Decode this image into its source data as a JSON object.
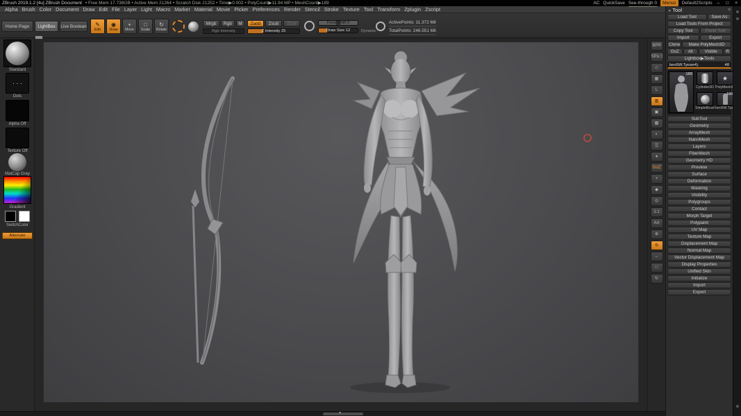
{
  "colors": {
    "accent_orange": "#c87616",
    "active_mode": "#e8962f",
    "cursor_ring": "#c44b3c"
  },
  "glyphs": {
    "pencil": "✎",
    "dot_brush": "◉",
    "move": "+",
    "scale": "□",
    "rotate": "↻",
    "chevron_down": "▾",
    "panel_collapse": "◂",
    "panel_menu": "≡",
    "star": "★",
    "dots_stroke": "· · ·"
  },
  "titlebar": {
    "app_title": "ZBrush 2019.1.2 [4u]  ZBrush Document",
    "stats": "•  Free Mem 17.738GB   •  Active Mem 21264   •  Scratch Disk 21252   •  Time▶0.002   •  PolyCount▶11.94 MP   •  MeshCount▶189",
    "ac": "AC",
    "quicksave": "QuickSave",
    "see_through": "See-through 0",
    "menus": "Menus",
    "scripts": "Default2Scripts",
    "window": {
      "minimize": "–",
      "maximize": "□",
      "close": "×"
    }
  },
  "menubar": {
    "items": [
      {
        "label": "Alpha",
        "name": "menu-alpha"
      },
      {
        "label": "Brush",
        "name": "menu-brush"
      },
      {
        "label": "Color",
        "name": "menu-color"
      },
      {
        "label": "Document",
        "name": "menu-document"
      },
      {
        "label": "Draw",
        "name": "menu-draw"
      },
      {
        "label": "Edit",
        "name": "menu-edit"
      },
      {
        "label": "File",
        "name": "menu-file"
      },
      {
        "label": "Layer",
        "name": "menu-layer"
      },
      {
        "label": "Light",
        "name": "menu-light"
      },
      {
        "label": "Macro",
        "name": "menu-macro"
      },
      {
        "label": "Marker",
        "name": "menu-marker"
      },
      {
        "label": "Material",
        "name": "menu-material"
      },
      {
        "label": "Movie",
        "name": "menu-movie"
      },
      {
        "label": "Picker",
        "name": "menu-picker"
      },
      {
        "label": "Preferences",
        "name": "menu-preferences"
      },
      {
        "label": "Render",
        "name": "menu-render"
      },
      {
        "label": "Stencil",
        "name": "menu-stencil"
      },
      {
        "label": "Stroke",
        "name": "menu-stroke"
      },
      {
        "label": "Texture",
        "name": "menu-texture"
      },
      {
        "label": "Tool",
        "name": "menu-tool"
      },
      {
        "label": "Transform",
        "name": "menu-transform"
      },
      {
        "label": "Zplugin",
        "name": "menu-zplugin"
      },
      {
        "label": "Zscript",
        "name": "menu-zscript"
      }
    ]
  },
  "shelf": {
    "home_page": "Home Page",
    "lightbox": "LightBox",
    "live_boolean": "Live Boolean",
    "edit": "Edit",
    "draw": "Draw",
    "move": "Move",
    "scale": "Scale",
    "rotate": "Rotate",
    "mrgb": "Mrgb",
    "rgb": "Rgb",
    "m": "M",
    "zadd": "Zadd",
    "zsub": "Zsub",
    "zcut": "Zcut",
    "rgb_intensity": "Rgb Intensity",
    "z_intensity": "Z Intensity 25",
    "focal_shift": "Focal Shift 0",
    "draw_size": "Draw Size 12",
    "dynamic": "Dynamic",
    "active_points": "ActivePoints: 11.372 Mil",
    "total_points": "TotalPoints: 246.551 Mil"
  },
  "left_tray": {
    "brush": "Standard",
    "stroke": "Dots",
    "alpha": "Alpha Off",
    "texture": "Texture Off",
    "material": "MatCap Gray",
    "color_picker": "Gradient",
    "switch": "SwitchColor",
    "alternate": "Alternate"
  },
  "right_shelf": {
    "icons": [
      {
        "t": "BPR",
        "name": "bpr-render-icon"
      },
      {
        "t": "SPix 3",
        "name": "spix-slider-icon"
      },
      {
        "t": "◇",
        "name": "persp-icon"
      },
      {
        "t": "▦",
        "name": "floor-grid-icon"
      },
      {
        "t": "L",
        "name": "local-transform-icon"
      },
      {
        "t": "▥",
        "name": "local-symmetry-icon",
        "cls": "active"
      },
      {
        "t": "▣",
        "name": "frame-icon"
      },
      {
        "t": "▩",
        "name": "polyframe-icon"
      },
      {
        "t": "◐",
        "name": "transparency-icon"
      },
      {
        "t": "▒",
        "name": "ghost-icon"
      },
      {
        "t": "●",
        "name": "solo-icon"
      },
      {
        "t": "GoZ",
        "name": "goz-icon",
        "cls": "accent"
      },
      {
        "t": "+",
        "name": "xpose-icon"
      },
      {
        "t": "◆",
        "name": "scroll-icon"
      },
      {
        "t": "◎",
        "name": "zoom-icon"
      },
      {
        "t": "1:1",
        "name": "actual-size-icon"
      },
      {
        "t": "AA",
        "name": "aa-half-icon"
      },
      {
        "t": "⊕",
        "name": "zoom-in-icon"
      },
      {
        "t": "⊖",
        "name": "zoom-out-icon",
        "cls": "active"
      },
      {
        "t": "↔",
        "name": "pan-icon"
      },
      {
        "t": "□",
        "name": "scale-view-icon"
      },
      {
        "t": "↻",
        "name": "rotate-view-icon"
      }
    ]
  },
  "tool_panel": {
    "title": "Tool",
    "buttons": {
      "load_tool": "Load Tool",
      "save_as": "Save As",
      "load_from_project": "Load Tools From Project",
      "copy_tool": "Copy Tool",
      "paste_tool": "Paste Tool",
      "import": "Import",
      "export": "Export",
      "clone": "Clone",
      "make_polymesh": "Make PolyMesh3D",
      "goz": "GoZ",
      "all": "All",
      "visible": "Visible",
      "r": "R",
      "lightbox_tools": "Lightbox▶Tools"
    },
    "tool_slider": {
      "label": "ben5W.Tpose4).",
      "value": "48"
    },
    "inventory": {
      "current_badge": "189",
      "items": [
        {
          "label": "Cylinder3D"
        },
        {
          "label": "PolyMesh3D"
        },
        {
          "label": "SimpleBrush"
        },
        {
          "label": "ben5W.Tpose4)",
          "badge": "189"
        }
      ]
    },
    "sections": [
      {
        "label": "SubTool",
        "name": "section-subtool"
      },
      {
        "label": "Geometry",
        "name": "section-geometry"
      },
      {
        "label": "ArrayMesh",
        "name": "section-arraymesh"
      },
      {
        "label": "NanoMesh",
        "name": "section-nanomesh"
      },
      {
        "label": "Layers",
        "name": "section-layers"
      },
      {
        "label": "FiberMesh",
        "name": "section-fibermesh"
      },
      {
        "label": "Geometry HD",
        "name": "section-geometry-hd"
      },
      {
        "label": "Preview",
        "name": "section-preview"
      },
      {
        "label": "Surface",
        "name": "section-surface"
      },
      {
        "label": "Deformation",
        "name": "section-deformation"
      },
      {
        "label": "Masking",
        "name": "section-masking"
      },
      {
        "label": "Visibility",
        "name": "section-visibility"
      },
      {
        "label": "Polygroups",
        "name": "section-polygroups"
      },
      {
        "label": "Contact",
        "name": "section-contact"
      },
      {
        "label": "Morph Target",
        "name": "section-morph-target"
      },
      {
        "label": "Polypaint",
        "name": "section-polypaint"
      },
      {
        "label": "UV Map",
        "name": "section-uv-map"
      },
      {
        "label": "Texture Map",
        "name": "section-texture-map"
      },
      {
        "label": "Displacement Map",
        "name": "section-displacement-map"
      },
      {
        "label": "Normal Map",
        "name": "section-normal-map"
      },
      {
        "label": "Vector Displacement Map",
        "name": "section-vector-displacement-map"
      },
      {
        "label": "Display Properties",
        "name": "section-display-properties"
      },
      {
        "label": "Unified Skin",
        "name": "section-unified-skin"
      },
      {
        "label": "Initialize",
        "name": "section-initialize"
      },
      {
        "label": "Import",
        "name": "section-import"
      },
      {
        "label": "Export",
        "name": "section-export"
      }
    ]
  }
}
